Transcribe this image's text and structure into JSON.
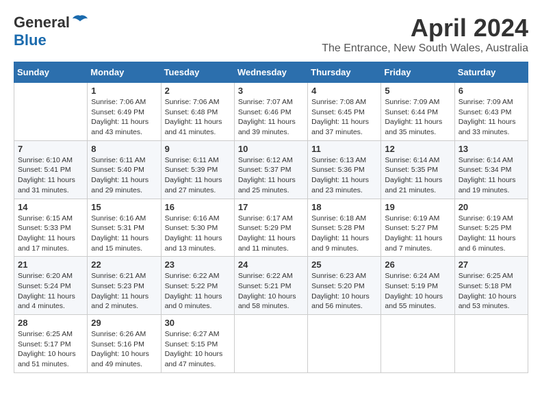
{
  "logo": {
    "general": "General",
    "blue": "Blue"
  },
  "title": "April 2024",
  "location": "The Entrance, New South Wales, Australia",
  "weekdays": [
    "Sunday",
    "Monday",
    "Tuesday",
    "Wednesday",
    "Thursday",
    "Friday",
    "Saturday"
  ],
  "weeks": [
    [
      {
        "day": "",
        "info": ""
      },
      {
        "day": "1",
        "info": "Sunrise: 7:06 AM\nSunset: 6:49 PM\nDaylight: 11 hours\nand 43 minutes."
      },
      {
        "day": "2",
        "info": "Sunrise: 7:06 AM\nSunset: 6:48 PM\nDaylight: 11 hours\nand 41 minutes."
      },
      {
        "day": "3",
        "info": "Sunrise: 7:07 AM\nSunset: 6:46 PM\nDaylight: 11 hours\nand 39 minutes."
      },
      {
        "day": "4",
        "info": "Sunrise: 7:08 AM\nSunset: 6:45 PM\nDaylight: 11 hours\nand 37 minutes."
      },
      {
        "day": "5",
        "info": "Sunrise: 7:09 AM\nSunset: 6:44 PM\nDaylight: 11 hours\nand 35 minutes."
      },
      {
        "day": "6",
        "info": "Sunrise: 7:09 AM\nSunset: 6:43 PM\nDaylight: 11 hours\nand 33 minutes."
      }
    ],
    [
      {
        "day": "7",
        "info": "Sunrise: 6:10 AM\nSunset: 5:41 PM\nDaylight: 11 hours\nand 31 minutes."
      },
      {
        "day": "8",
        "info": "Sunrise: 6:11 AM\nSunset: 5:40 PM\nDaylight: 11 hours\nand 29 minutes."
      },
      {
        "day": "9",
        "info": "Sunrise: 6:11 AM\nSunset: 5:39 PM\nDaylight: 11 hours\nand 27 minutes."
      },
      {
        "day": "10",
        "info": "Sunrise: 6:12 AM\nSunset: 5:37 PM\nDaylight: 11 hours\nand 25 minutes."
      },
      {
        "day": "11",
        "info": "Sunrise: 6:13 AM\nSunset: 5:36 PM\nDaylight: 11 hours\nand 23 minutes."
      },
      {
        "day": "12",
        "info": "Sunrise: 6:14 AM\nSunset: 5:35 PM\nDaylight: 11 hours\nand 21 minutes."
      },
      {
        "day": "13",
        "info": "Sunrise: 6:14 AM\nSunset: 5:34 PM\nDaylight: 11 hours\nand 19 minutes."
      }
    ],
    [
      {
        "day": "14",
        "info": "Sunrise: 6:15 AM\nSunset: 5:33 PM\nDaylight: 11 hours\nand 17 minutes."
      },
      {
        "day": "15",
        "info": "Sunrise: 6:16 AM\nSunset: 5:31 PM\nDaylight: 11 hours\nand 15 minutes."
      },
      {
        "day": "16",
        "info": "Sunrise: 6:16 AM\nSunset: 5:30 PM\nDaylight: 11 hours\nand 13 minutes."
      },
      {
        "day": "17",
        "info": "Sunrise: 6:17 AM\nSunset: 5:29 PM\nDaylight: 11 hours\nand 11 minutes."
      },
      {
        "day": "18",
        "info": "Sunrise: 6:18 AM\nSunset: 5:28 PM\nDaylight: 11 hours\nand 9 minutes."
      },
      {
        "day": "19",
        "info": "Sunrise: 6:19 AM\nSunset: 5:27 PM\nDaylight: 11 hours\nand 7 minutes."
      },
      {
        "day": "20",
        "info": "Sunrise: 6:19 AM\nSunset: 5:25 PM\nDaylight: 11 hours\nand 6 minutes."
      }
    ],
    [
      {
        "day": "21",
        "info": "Sunrise: 6:20 AM\nSunset: 5:24 PM\nDaylight: 11 hours\nand 4 minutes."
      },
      {
        "day": "22",
        "info": "Sunrise: 6:21 AM\nSunset: 5:23 PM\nDaylight: 11 hours\nand 2 minutes."
      },
      {
        "day": "23",
        "info": "Sunrise: 6:22 AM\nSunset: 5:22 PM\nDaylight: 11 hours\nand 0 minutes."
      },
      {
        "day": "24",
        "info": "Sunrise: 6:22 AM\nSunset: 5:21 PM\nDaylight: 10 hours\nand 58 minutes."
      },
      {
        "day": "25",
        "info": "Sunrise: 6:23 AM\nSunset: 5:20 PM\nDaylight: 10 hours\nand 56 minutes."
      },
      {
        "day": "26",
        "info": "Sunrise: 6:24 AM\nSunset: 5:19 PM\nDaylight: 10 hours\nand 55 minutes."
      },
      {
        "day": "27",
        "info": "Sunrise: 6:25 AM\nSunset: 5:18 PM\nDaylight: 10 hours\nand 53 minutes."
      }
    ],
    [
      {
        "day": "28",
        "info": "Sunrise: 6:25 AM\nSunset: 5:17 PM\nDaylight: 10 hours\nand 51 minutes."
      },
      {
        "day": "29",
        "info": "Sunrise: 6:26 AM\nSunset: 5:16 PM\nDaylight: 10 hours\nand 49 minutes."
      },
      {
        "day": "30",
        "info": "Sunrise: 6:27 AM\nSunset: 5:15 PM\nDaylight: 10 hours\nand 47 minutes."
      },
      {
        "day": "",
        "info": ""
      },
      {
        "day": "",
        "info": ""
      },
      {
        "day": "",
        "info": ""
      },
      {
        "day": "",
        "info": ""
      }
    ]
  ]
}
